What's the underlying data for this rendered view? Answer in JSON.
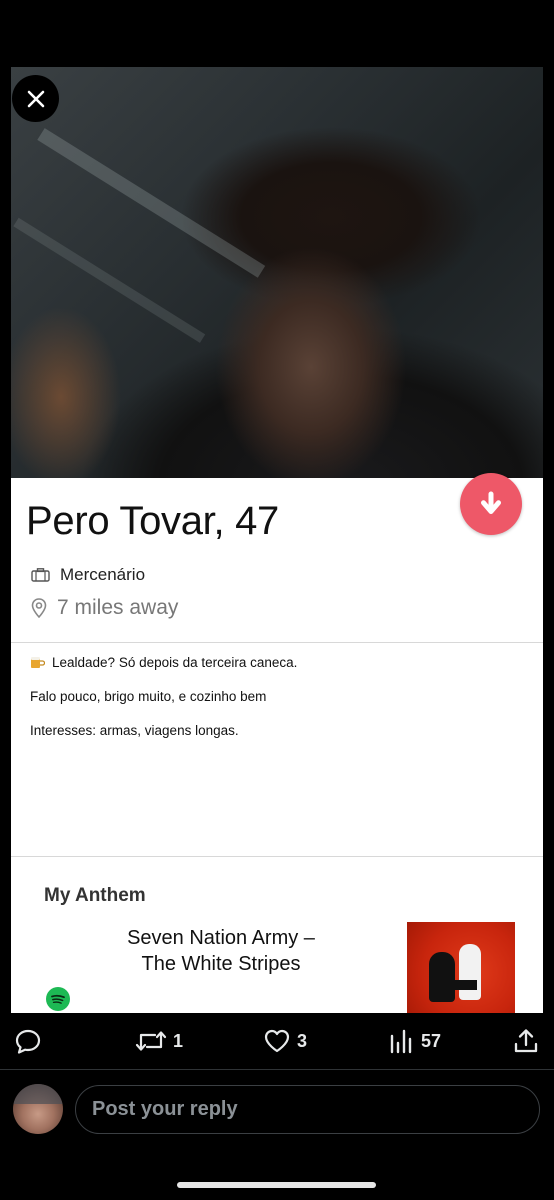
{
  "profile": {
    "name_age": "Pero Tovar, 47",
    "job": "Mercenário",
    "distance": "7 miles away",
    "bio_lines": [
      "Lealdade? Só depois da terceira caneca.",
      "Falo pouco, brigo muito, e cozinho bem",
      "Interesses: armas, viagens longas."
    ],
    "anthem": {
      "label": "My Anthem",
      "song_line1": "Seven Nation Army –",
      "song_line2": "The White Stripes"
    },
    "accent_color": "#ee5868"
  },
  "actions": {
    "reply_count": "",
    "retweet_count": "1",
    "like_count": "3",
    "views_count": "57"
  },
  "reply_bar": {
    "placeholder": "Post your reply"
  }
}
